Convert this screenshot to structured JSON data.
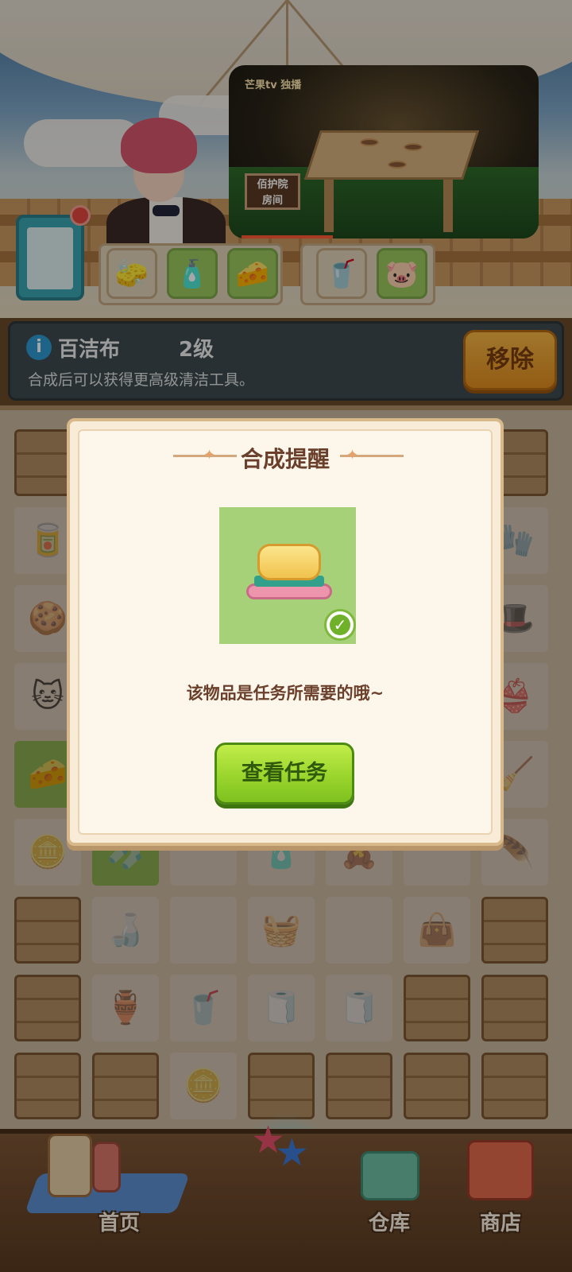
{
  "video": {
    "logo": "芒果tv 独播",
    "sign_line1": "佰护院",
    "sign_line2": "房间"
  },
  "info": {
    "icon": "i",
    "item_name": "百洁布",
    "level": "2级",
    "description": "合成后可以获得更高级清洁工具。",
    "remove_label": "移除"
  },
  "modal": {
    "title": "合成提醒",
    "message": "该物品是任务所需要的哦~",
    "button_label": "查看任务",
    "check_icon": "✓"
  },
  "nav": {
    "home_label": "首页",
    "warehouse_label": "仓库",
    "shop_label": "商店"
  },
  "colors": {
    "accent_green": "#9ad52d",
    "accent_orange": "#f6b746",
    "text_brown": "#6a3f2b"
  }
}
